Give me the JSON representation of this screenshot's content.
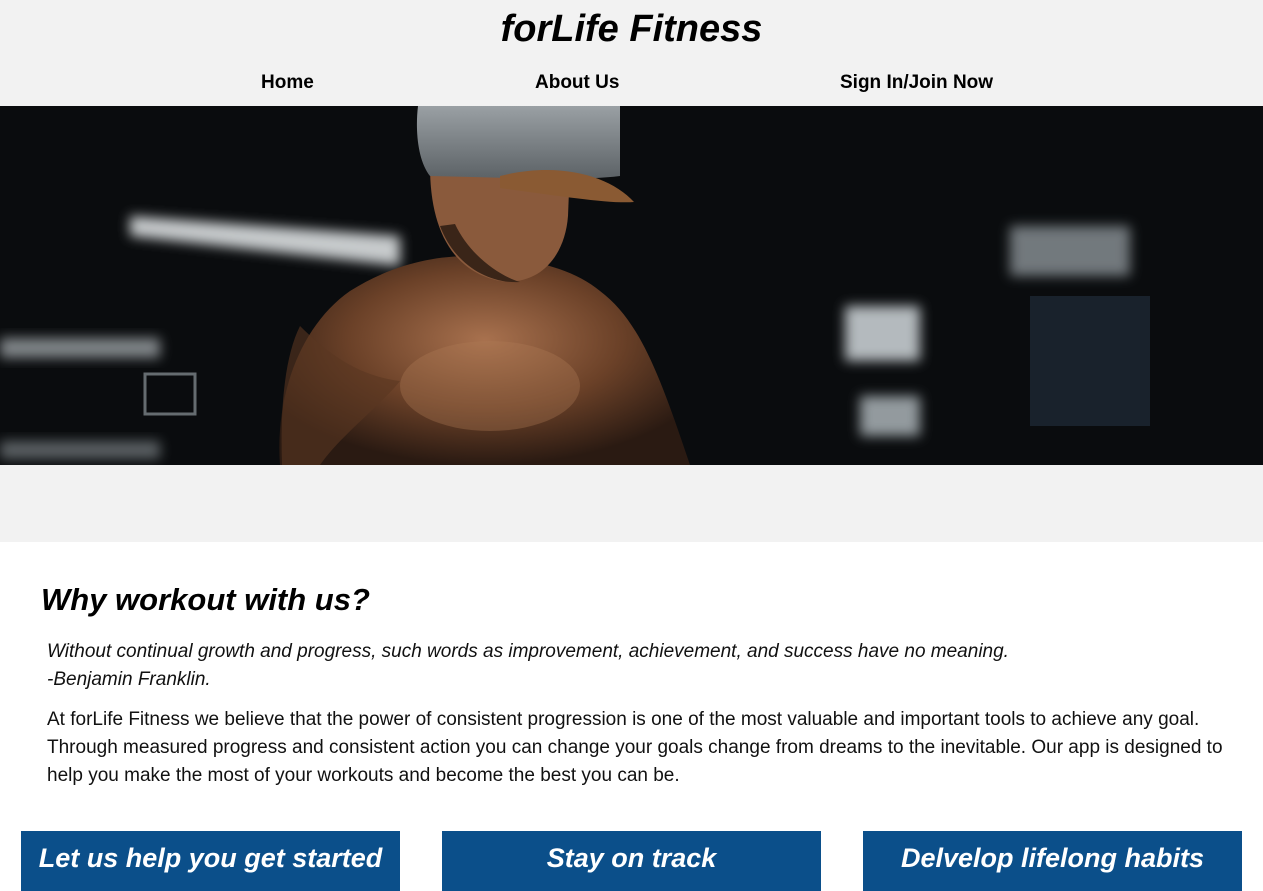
{
  "header": {
    "title": "forLife Fitness",
    "nav": [
      {
        "label": "Home"
      },
      {
        "label": "About Us"
      },
      {
        "label": "Sign In/Join Now"
      }
    ]
  },
  "hero": {
    "icon": "gym-athlete-photo"
  },
  "why": {
    "title": "Why workout with us?",
    "quote_text": "Without continual growth and progress, such words as improvement, achievement, and success have no meaning.",
    "quote_author": "-Benjamin Franklin.",
    "description": "At forLife Fitness we believe that the power of consistent progression is one of the most valuable and important tools to achieve any goal. Through measured progress and consistent action you can change your goals change from dreams to the inevitable. Our app is designed to help you make the most of your workouts and become the best you can be."
  },
  "cards": [
    {
      "label": "Let us help you get started"
    },
    {
      "label": "Stay on track"
    },
    {
      "label": "Delvelop lifelong habits"
    }
  ],
  "colors": {
    "header_bg": "#f2f2f2",
    "card_bg": "#0b4f8a",
    "text": "#111111"
  }
}
